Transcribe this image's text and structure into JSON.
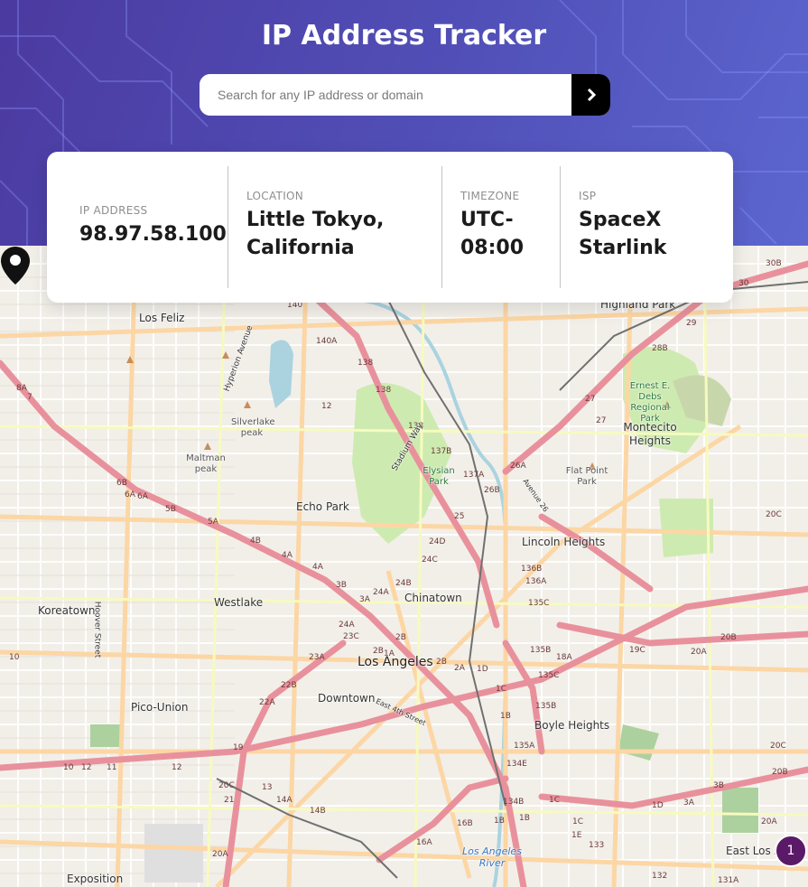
{
  "header": {
    "title": "IP Address Tracker",
    "search_placeholder": "Search for any IP address or domain",
    "search_value": "",
    "submit_icon": "chevron-right-icon"
  },
  "info": {
    "ip": {
      "label": "IP ADDRESS",
      "value": "98.97.58.100"
    },
    "location": {
      "label": "LOCATION",
      "line1": "Little Tokyo,",
      "line2": "California"
    },
    "timezone": {
      "label": "TIMEZONE",
      "line1": "UTC-",
      "line2": "08:00"
    },
    "isp": {
      "label": "ISP",
      "line1": "SpaceX",
      "line2": "Starlink"
    }
  },
  "map": {
    "labels": {
      "los_feliz": "Los Feliz",
      "highland_park": "Highland Park",
      "silverlake_peak": "Silverlake peak",
      "maltman_peak": "Maltman peak",
      "elysian_park": "Elysian Park",
      "ernest_debs": "Ernest E. Debs Regional Park",
      "montecito_heights": "Montecito Heights",
      "flat_point_park": "Flat Point Park",
      "echo_park": "Echo Park",
      "lincoln_heights": "Lincoln Heights",
      "chinatown": "Chinatown",
      "westlake": "Westlake",
      "koreatown": "Koreatown",
      "los_angeles": "Los Angeles",
      "downtown": "Downtown",
      "pico_union": "Pico-Union",
      "boyle_heights": "Boyle Heights",
      "los_angeles_river": "Los Angeles River",
      "exposition": "Exposition",
      "east_los_angeles": "East Los A",
      "stadium_way": "Stadium Way",
      "hyperion_avenue": "Hyperion Avenue",
      "hoover_street": "Hoover Street",
      "east_4th_street": "East 4th Street",
      "avenue_26": "Avenue 26"
    },
    "marker_icon": "location-pin-icon",
    "badge_count": "1",
    "colors": {
      "highway": "#e8919c",
      "primary": "#fcd6a4",
      "park": "#cdebb0",
      "water": "#aad3df"
    }
  }
}
